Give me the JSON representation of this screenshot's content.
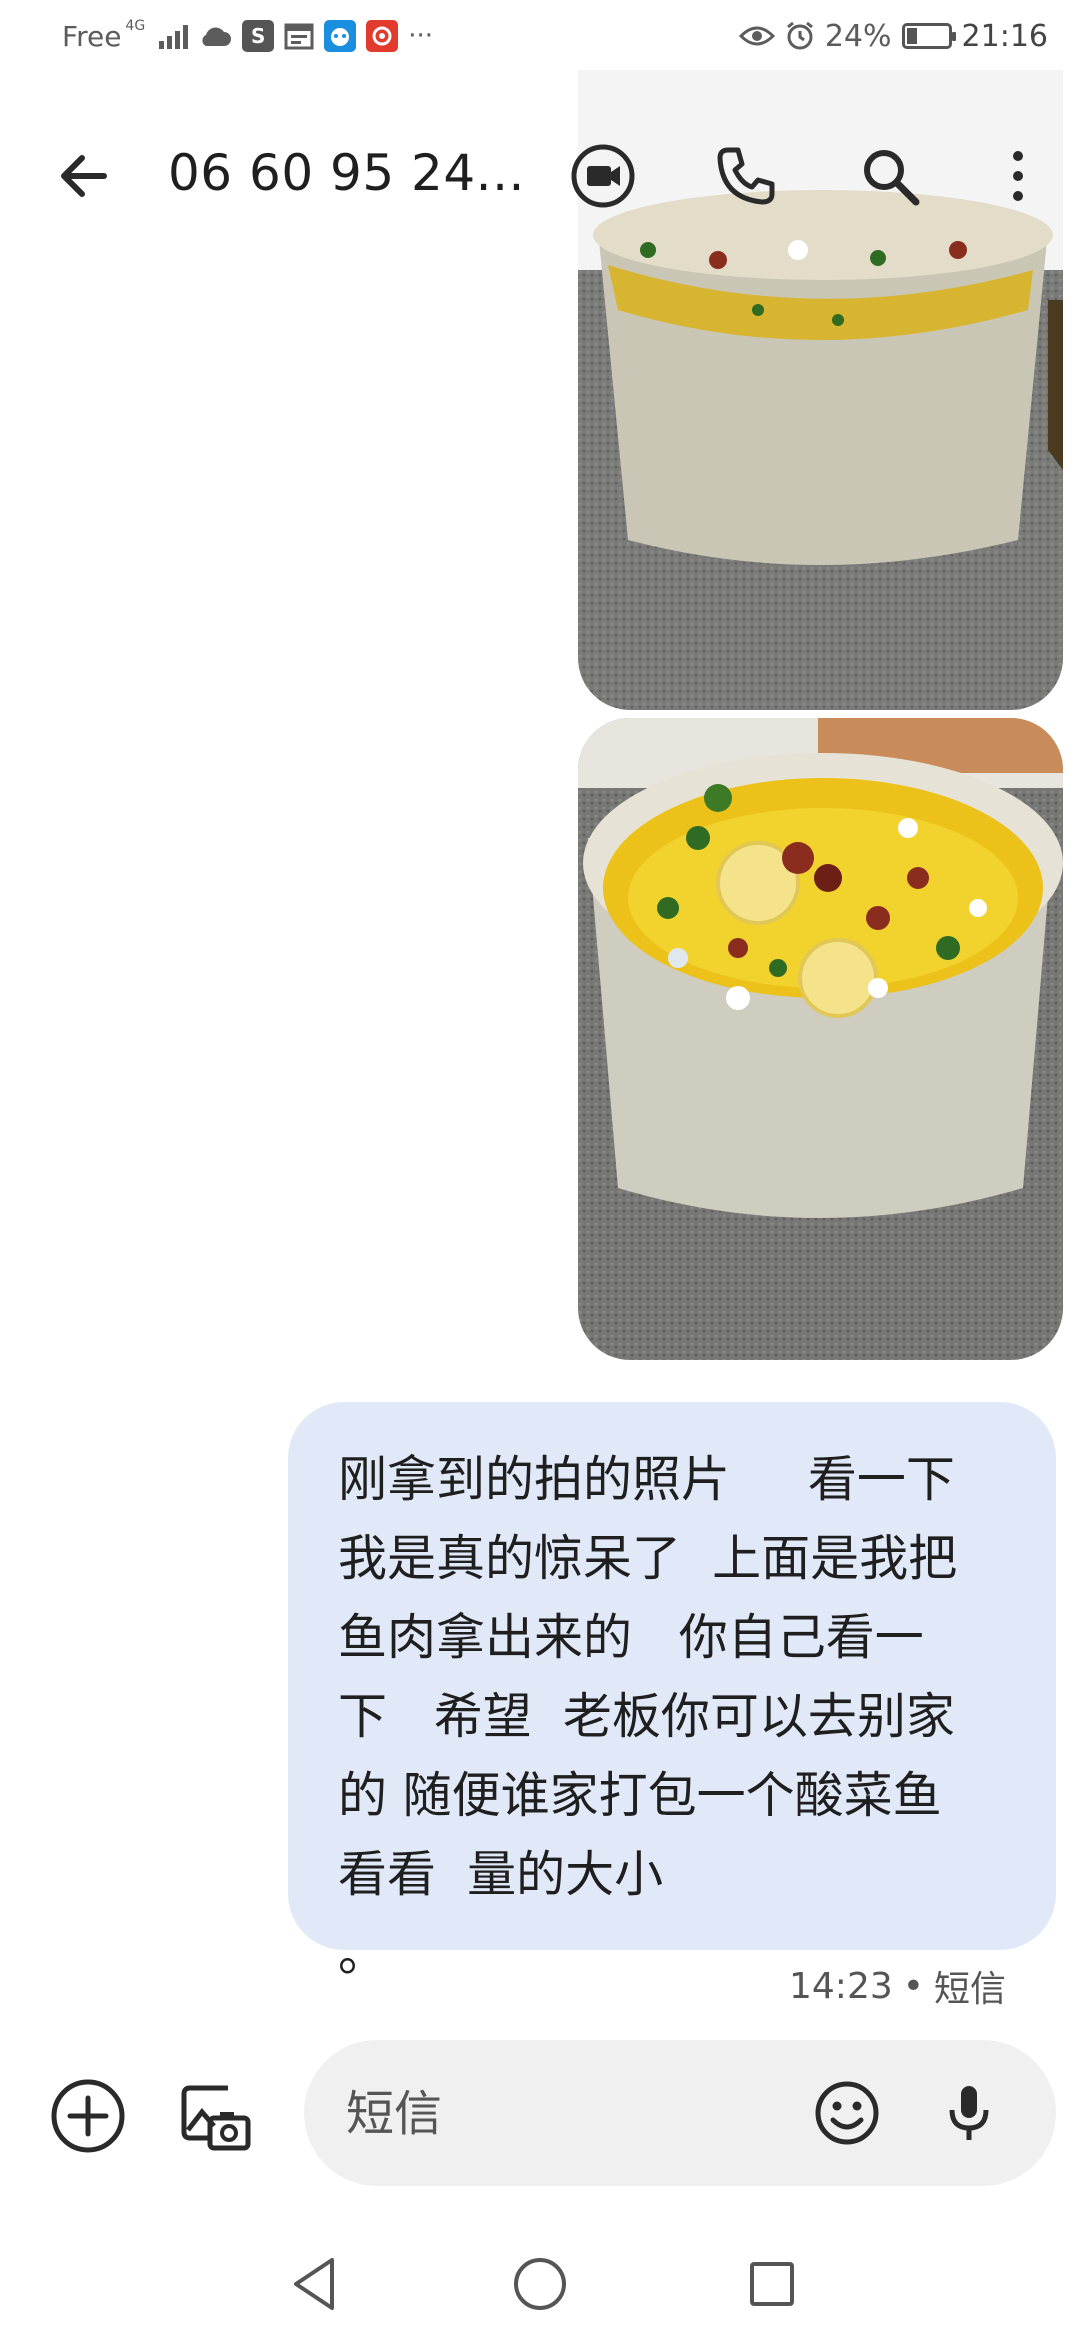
{
  "status_bar": {
    "carrier": "Free",
    "network": "4G",
    "more": "···",
    "battery": "24%",
    "battery_level": 0.24,
    "time": "21:16",
    "app_badge_s": "S"
  },
  "header": {
    "contact": "06 60 95 24..."
  },
  "conversation": {
    "message_text": "刚拿到的拍的照片     看一下\n我是真的惊呆了  上面是我把\n鱼肉拿出来的   你自己看一\n下   希望  老板你可以去别家\n的 随便谁家打包一个酸菜鱼\n看看  量的大小\n。",
    "message_time": "14:23",
    "message_separator": "•",
    "message_type": "短信"
  },
  "compose": {
    "placeholder": "短信"
  },
  "icons": {
    "back": "arrow-left-icon",
    "video": "video-call-icon",
    "phone": "phone-icon",
    "search": "search-icon",
    "more": "more-vert-icon",
    "add": "add-circle-icon",
    "gallery": "gallery-camera-icon",
    "emoji": "emoji-icon",
    "mic": "mic-icon",
    "nav_back": "nav-back-icon",
    "nav_home": "nav-home-icon",
    "nav_recents": "nav-recents-icon"
  },
  "colors": {
    "bubble": "#e1e9f8",
    "compose": "#f0f0f0",
    "icon": "#3c3c3c"
  }
}
